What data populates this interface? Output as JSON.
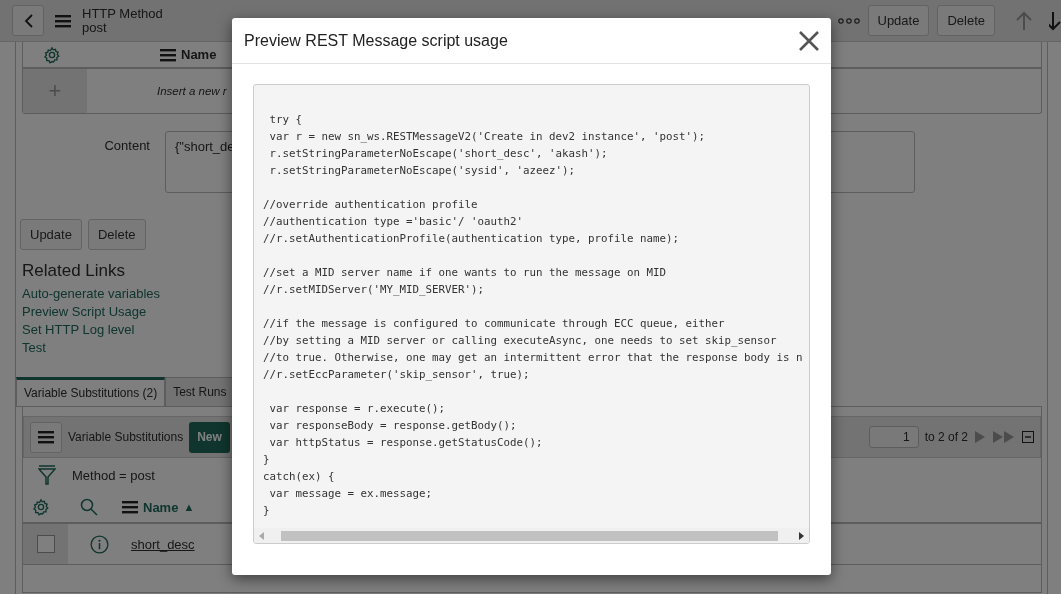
{
  "header": {
    "title": "HTTP Method",
    "subtitle": "post",
    "buttons": [
      "Update",
      "Delete"
    ]
  },
  "top_list": {
    "column": "Name",
    "add": "+",
    "insert_placeholder": "Insert a new r"
  },
  "content": {
    "label": "Content",
    "value": "{\"short_de"
  },
  "form_buttons": [
    "Update",
    "Delete"
  ],
  "related_links": {
    "title": "Related Links",
    "links": [
      "Auto-generate variables",
      "Preview Script Usage",
      "Set HTTP Log level",
      "Test"
    ]
  },
  "tabs": [
    {
      "label": "Variable Substitutions (2)",
      "selected": true
    },
    {
      "label": "Test Runs",
      "selected": false
    }
  ],
  "list": {
    "title": "Variable Substitutions",
    "new_button": "New",
    "page": "1",
    "range": "to 2 of 2",
    "filter": "Method = post",
    "sort_column": "Name",
    "sort_indicator": "▲",
    "rows": [
      {
        "name": "short_desc",
        "checked": false
      }
    ]
  },
  "modal": {
    "title": "Preview REST Message script usage",
    "script": " try {\n var r = new sn_ws.RESTMessageV2('Create in dev2 instance', 'post');\n r.setStringParameterNoEscape('short_desc', 'akash');\n r.setStringParameterNoEscape('sysid', 'azeez');\n\n//override authentication profile\n//authentication type ='basic'/ 'oauth2'\n//r.setAuthenticationProfile(authentication type, profile name);\n\n//set a MID server name if one wants to run the message on MID\n//r.setMIDServer('MY_MID_SERVER');\n\n//if the message is configured to communicate through ECC queue, either\n//by setting a MID server or calling executeAsync, one needs to set skip_sensor\n//to true. Otherwise, one may get an intermittent error that the response body is n\n//r.setEccParameter('skip_sensor', true);\n\n var response = r.execute();\n var responseBody = response.getBody();\n var httpStatus = response.getStatusCode();\n}\ncatch(ex) {\n var message = ex.message;\n}"
  }
}
